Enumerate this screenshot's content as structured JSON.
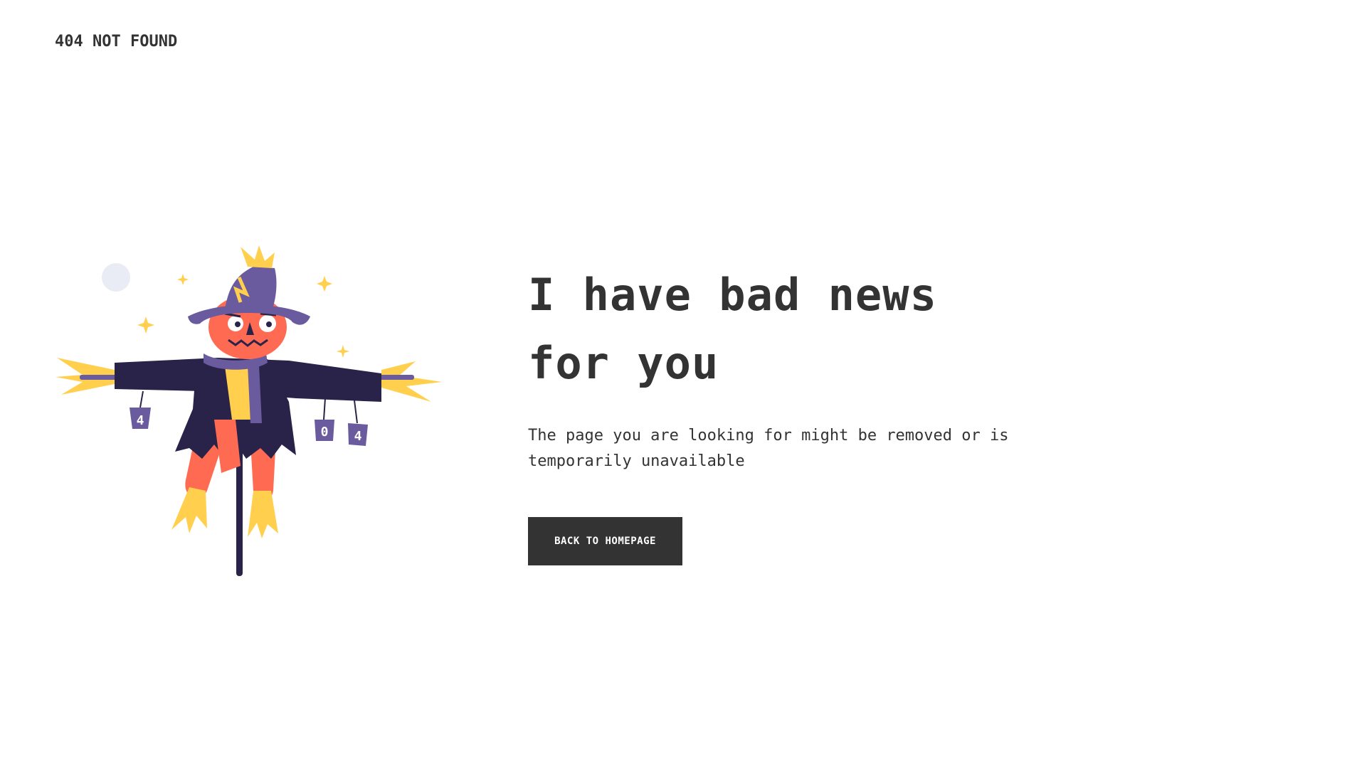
{
  "header": {
    "brand_text": "404 NOT FOUND"
  },
  "illustration": {
    "subject": "scarecrow",
    "can_labels": [
      "4",
      "0",
      "4"
    ],
    "colors": {
      "hat": "#6a5a9e",
      "coat": "#29234a",
      "face": "#ff6b52",
      "straw": "#ffcf4d",
      "scarf": "#6a5a9e",
      "moon": "#e9ebf5"
    }
  },
  "main": {
    "headline_line1": "I have bad news",
    "headline_line2": "for you",
    "subtext": "The page you are looking for might be removed or is temporarily unavailable",
    "cta_label": "BACK TO HOMEPAGE"
  },
  "colors": {
    "text": "#333333",
    "button_bg": "#333333",
    "button_text": "#ffffff",
    "background": "#ffffff"
  }
}
